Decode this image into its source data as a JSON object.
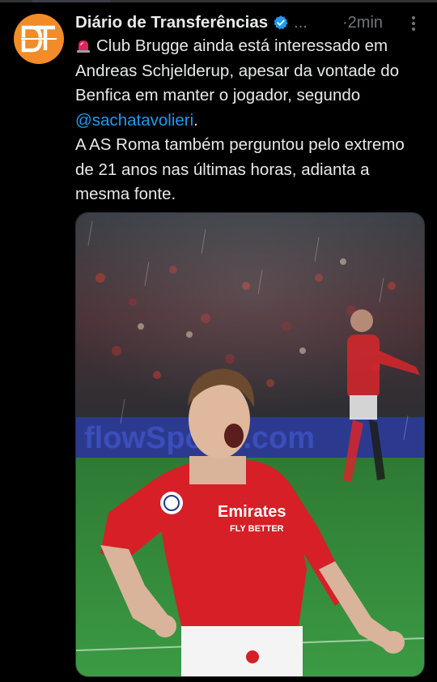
{
  "tweet": {
    "author": {
      "display_name": "Diário de Transferências",
      "handle_truncated": "...",
      "avatar_icon": "dt-logo-icon",
      "verified": true
    },
    "timestamp": "·2min",
    "text": {
      "line1": "Club Brugge ainda está interessado em Andreas Schjelderup, apesar da vontade do Benfica em manter o jogador, segundo ",
      "mention": "@sachatavolieri",
      "line1_end": ".",
      "line2": "A AS Roma também perguntou pelo extremo de 21 anos nas últimas horas, adianta a mesma fonte."
    },
    "media": {
      "type": "photo",
      "shirt_text_1": "Emirates",
      "shirt_text_2": "FLY BETTER"
    }
  },
  "colors": {
    "background": "#000000",
    "text": "#e7e9ea",
    "secondary": "#71767b",
    "link": "#1d9bf0",
    "verified": "#1d9bf0",
    "avatar": "#f28c28"
  }
}
